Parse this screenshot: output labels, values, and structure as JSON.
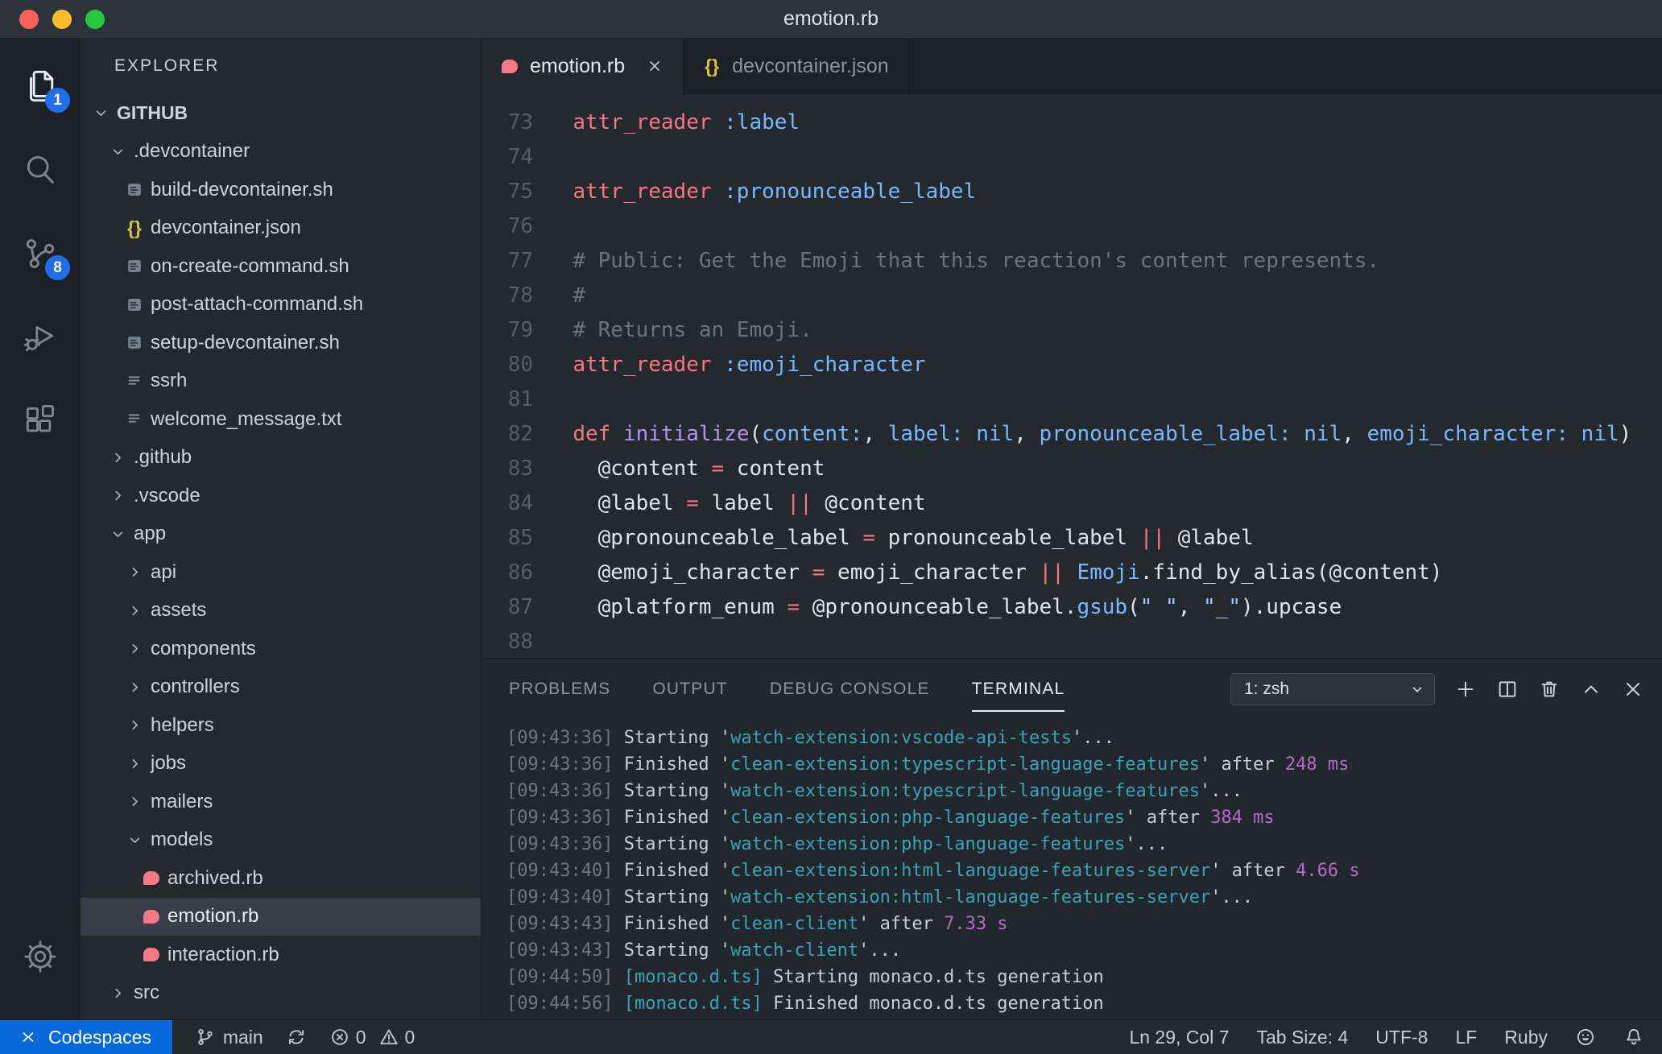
{
  "window": {
    "title": "emotion.rb"
  },
  "colors": {
    "badge_blue": "#1f6feb",
    "remote_blue": "#0969da",
    "ruby_pink": "#f8788a",
    "json_yellow": "#d9c337",
    "keyword_red": "#f97583",
    "function_purple": "#b392f0",
    "symbol_blue": "#79b8ff",
    "string_blue": "#9ecbff",
    "comment_gray": "#6a737d",
    "terminal_teal": "#3aa3b5",
    "terminal_magenta": "#b36bc8"
  },
  "activity_bar": {
    "items": [
      {
        "name": "explorer",
        "icon": "files",
        "badge": "1",
        "active": true
      },
      {
        "name": "search",
        "icon": "search"
      },
      {
        "name": "source-control",
        "icon": "scm",
        "badge": "8"
      },
      {
        "name": "run-debug",
        "icon": "debug"
      },
      {
        "name": "extensions",
        "icon": "ext"
      }
    ],
    "bottom": [
      {
        "name": "settings",
        "icon": "gear"
      }
    ]
  },
  "sidebar": {
    "title": "EXPLORER",
    "tree": [
      {
        "label": "GITHUB",
        "level": 0,
        "kind": "folder-open",
        "bold": true
      },
      {
        "label": ".devcontainer",
        "level": 1,
        "kind": "folder-open"
      },
      {
        "label": "build-devcontainer.sh",
        "level": 2,
        "kind": "sh"
      },
      {
        "label": "devcontainer.json",
        "level": 2,
        "kind": "json"
      },
      {
        "label": "on-create-command.sh",
        "level": 2,
        "kind": "sh"
      },
      {
        "label": "post-attach-command.sh",
        "level": 2,
        "kind": "sh"
      },
      {
        "label": "setup-devcontainer.sh",
        "level": 2,
        "kind": "sh"
      },
      {
        "label": "ssrh",
        "level": 2,
        "kind": "txt"
      },
      {
        "label": "welcome_message.txt",
        "level": 2,
        "kind": "txt"
      },
      {
        "label": ".github",
        "level": 1,
        "kind": "folder-closed"
      },
      {
        "label": ".vscode",
        "level": 1,
        "kind": "folder-closed"
      },
      {
        "label": "app",
        "level": 1,
        "kind": "folder-open"
      },
      {
        "label": "api",
        "level": 2,
        "kind": "folder-closed"
      },
      {
        "label": "assets",
        "level": 2,
        "kind": "folder-closed"
      },
      {
        "label": "components",
        "level": 2,
        "kind": "folder-closed"
      },
      {
        "label": "controllers",
        "level": 2,
        "kind": "folder-closed"
      },
      {
        "label": "helpers",
        "level": 2,
        "kind": "folder-closed"
      },
      {
        "label": "jobs",
        "level": 2,
        "kind": "folder-closed"
      },
      {
        "label": "mailers",
        "level": 2,
        "kind": "folder-closed"
      },
      {
        "label": "models",
        "level": 2,
        "kind": "folder-open"
      },
      {
        "label": "archived.rb",
        "level": 3,
        "kind": "ruby"
      },
      {
        "label": "emotion.rb",
        "level": 3,
        "kind": "ruby",
        "selected": true
      },
      {
        "label": "interaction.rb",
        "level": 3,
        "kind": "ruby"
      },
      {
        "label": "src",
        "level": 1,
        "kind": "folder-closed"
      }
    ]
  },
  "tabs": [
    {
      "label": "emotion.rb",
      "icon": "ruby",
      "active": true
    },
    {
      "label": "devcontainer.json",
      "icon": "json",
      "active": false
    }
  ],
  "editor": {
    "lines": [
      {
        "num": "73",
        "tokens": [
          [
            "p",
            "  "
          ],
          [
            "k",
            "attr_reader"
          ],
          [
            "p",
            " "
          ],
          [
            "b",
            ":label"
          ]
        ]
      },
      {
        "num": "74",
        "tokens": []
      },
      {
        "num": "75",
        "tokens": [
          [
            "p",
            "  "
          ],
          [
            "k",
            "attr_reader"
          ],
          [
            "p",
            " "
          ],
          [
            "b",
            ":pronounceable_label"
          ]
        ]
      },
      {
        "num": "76",
        "tokens": []
      },
      {
        "num": "77",
        "tokens": [
          [
            "p",
            "  "
          ],
          [
            "c",
            "# Public: Get the Emoji that this reaction's content represents."
          ]
        ]
      },
      {
        "num": "78",
        "tokens": [
          [
            "p",
            "  "
          ],
          [
            "c",
            "#"
          ]
        ]
      },
      {
        "num": "79",
        "tokens": [
          [
            "p",
            "  "
          ],
          [
            "c",
            "# Returns an Emoji."
          ]
        ]
      },
      {
        "num": "80",
        "tokens": [
          [
            "p",
            "  "
          ],
          [
            "k",
            "attr_reader"
          ],
          [
            "p",
            " "
          ],
          [
            "b",
            ":emoji_character"
          ]
        ]
      },
      {
        "num": "81",
        "tokens": []
      },
      {
        "num": "82",
        "tokens": [
          [
            "p",
            "  "
          ],
          [
            "k",
            "def"
          ],
          [
            "p",
            " "
          ],
          [
            "f",
            "initialize"
          ],
          [
            "p",
            "("
          ],
          [
            "b",
            "content:"
          ],
          [
            "p",
            ", "
          ],
          [
            "b",
            "label:"
          ],
          [
            "p",
            " "
          ],
          [
            "b",
            "nil"
          ],
          [
            "p",
            ", "
          ],
          [
            "b",
            "pronounceable_label:"
          ],
          [
            "p",
            " "
          ],
          [
            "b",
            "nil"
          ],
          [
            "p",
            ", "
          ],
          [
            "b",
            "emoji_character:"
          ],
          [
            "p",
            " "
          ],
          [
            "b",
            "nil"
          ],
          [
            "p",
            ")"
          ]
        ]
      },
      {
        "num": "83",
        "tokens": [
          [
            "p",
            "    @content "
          ],
          [
            "k",
            "="
          ],
          [
            "p",
            " content"
          ]
        ]
      },
      {
        "num": "84",
        "tokens": [
          [
            "p",
            "    @label "
          ],
          [
            "k",
            "="
          ],
          [
            "p",
            " label "
          ],
          [
            "k",
            "||"
          ],
          [
            "p",
            " @content"
          ]
        ]
      },
      {
        "num": "85",
        "tokens": [
          [
            "p",
            "    @pronounceable_label "
          ],
          [
            "k",
            "="
          ],
          [
            "p",
            " pronounceable_label "
          ],
          [
            "k",
            "||"
          ],
          [
            "p",
            " @label"
          ]
        ]
      },
      {
        "num": "86",
        "tokens": [
          [
            "p",
            "    @emoji_character "
          ],
          [
            "k",
            "="
          ],
          [
            "p",
            " emoji_character "
          ],
          [
            "k",
            "||"
          ],
          [
            "p",
            " "
          ],
          [
            "b",
            "Emoji"
          ],
          [
            "p",
            ".find_by_alias(@content)"
          ]
        ]
      },
      {
        "num": "87",
        "tokens": [
          [
            "p",
            "    @platform_enum "
          ],
          [
            "k",
            "="
          ],
          [
            "p",
            " @pronounceable_label."
          ],
          [
            "b",
            "gsub"
          ],
          [
            "p",
            "("
          ],
          [
            "s",
            "\" \""
          ],
          [
            "p",
            ", "
          ],
          [
            "s",
            "\"_\""
          ],
          [
            "p",
            ").upcase"
          ]
        ]
      },
      {
        "num": "88",
        "tokens": []
      }
    ]
  },
  "panel": {
    "tabs": [
      {
        "label": "PROBLEMS",
        "active": false
      },
      {
        "label": "OUTPUT",
        "active": false
      },
      {
        "label": "DEBUG CONSOLE",
        "active": false
      },
      {
        "label": "TERMINAL",
        "active": true
      }
    ],
    "terminal_selector": "1: zsh"
  },
  "terminal": {
    "lines": [
      [
        [
          "g",
          "[09:43:36] "
        ],
        [
          "w",
          "Starting '"
        ],
        [
          "t",
          "watch-extension:vscode-api-tests"
        ],
        [
          "w",
          "'..."
        ]
      ],
      [
        [
          "g",
          "[09:43:36] "
        ],
        [
          "w",
          "Finished '"
        ],
        [
          "t",
          "clean-extension:typescript-language-features"
        ],
        [
          "w",
          "' after "
        ],
        [
          "m",
          "248 ms"
        ]
      ],
      [
        [
          "g",
          "[09:43:36] "
        ],
        [
          "w",
          "Starting '"
        ],
        [
          "t",
          "watch-extension:typescript-language-features"
        ],
        [
          "w",
          "'..."
        ]
      ],
      [
        [
          "g",
          "[09:43:36] "
        ],
        [
          "w",
          "Finished '"
        ],
        [
          "t",
          "clean-extension:php-language-features"
        ],
        [
          "w",
          "' after "
        ],
        [
          "m",
          "384 ms"
        ]
      ],
      [
        [
          "g",
          "[09:43:36] "
        ],
        [
          "w",
          "Starting '"
        ],
        [
          "t",
          "watch-extension:php-language-features"
        ],
        [
          "w",
          "'..."
        ]
      ],
      [
        [
          "g",
          "[09:43:40] "
        ],
        [
          "w",
          "Finished '"
        ],
        [
          "t",
          "clean-extension:html-language-features-server"
        ],
        [
          "w",
          "' after "
        ],
        [
          "m",
          "4.66 s"
        ]
      ],
      [
        [
          "g",
          "[09:43:40] "
        ],
        [
          "w",
          "Starting '"
        ],
        [
          "t",
          "watch-extension:html-language-features-server"
        ],
        [
          "w",
          "'..."
        ]
      ],
      [
        [
          "g",
          "[09:43:43] "
        ],
        [
          "w",
          "Finished '"
        ],
        [
          "t",
          "clean-client"
        ],
        [
          "w",
          "' after "
        ],
        [
          "m",
          "7.33 s"
        ]
      ],
      [
        [
          "g",
          "[09:43:43] "
        ],
        [
          "w",
          "Starting '"
        ],
        [
          "t",
          "watch-client"
        ],
        [
          "w",
          "'..."
        ]
      ],
      [
        [
          "g",
          "[09:44:50] "
        ],
        [
          "t",
          "[monaco.d.ts]"
        ],
        [
          "w",
          " Starting monaco.d.ts generation"
        ]
      ],
      [
        [
          "g",
          "[09:44:56] "
        ],
        [
          "t",
          "[monaco.d.ts]"
        ],
        [
          "w",
          " Finished monaco.d.ts generation"
        ]
      ]
    ]
  },
  "status_bar": {
    "remote": {
      "label": "Codespaces"
    },
    "branch": {
      "label": "main"
    },
    "problems": {
      "errors": "0",
      "warnings": "0"
    },
    "right": {
      "cursor": "Ln 29, Col 7",
      "tab_size": "Tab Size: 4",
      "encoding": "UTF-8",
      "eol": "LF",
      "language": "Ruby"
    }
  }
}
